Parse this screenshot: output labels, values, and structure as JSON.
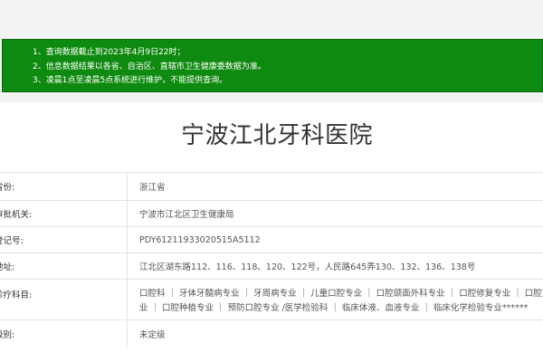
{
  "notice": {
    "lines": [
      "1、查询数据截止到2023年4月9日22时；",
      "2、信息数据结果以各省、自治区、直辖市卫生健康委数据为准。",
      "3、凌晨1点至凌晨5点系统进行维护，不能提供查询。"
    ]
  },
  "hospital": {
    "name": "宁波江北牙科医院"
  },
  "info": [
    {
      "label": "省份:",
      "value": "浙江省"
    },
    {
      "label": "审批机关:",
      "value": "宁波市江北区卫生健康局"
    },
    {
      "label": "登记号:",
      "value": "PDY61211933020515A5112"
    },
    {
      "label": "地址:",
      "value": "江北区湖东路112、116、118、120、122号，人民路645弄130、132、136、138号"
    },
    {
      "label": "诊疗科目:",
      "value_lines": [
        "口腔科 ｜ 牙体牙髓病专业 ｜ 牙周病专业 ｜ 儿童口腔专业 ｜ 口腔颌面外科专业 ｜ 口腔修复专业 ｜ 口腔正畸专",
        "业 ｜ 口腔种植专业 ｜ 预防口腔专业 /医学检验科 ｜ 临床体液、血液专业 ｜ 临床化学检验专业******"
      ]
    },
    {
      "label": "级别:",
      "value": "未定级"
    }
  ],
  "colors": {
    "notice_bg": "#0f8a10",
    "page_bg": "#f3f3f3"
  }
}
